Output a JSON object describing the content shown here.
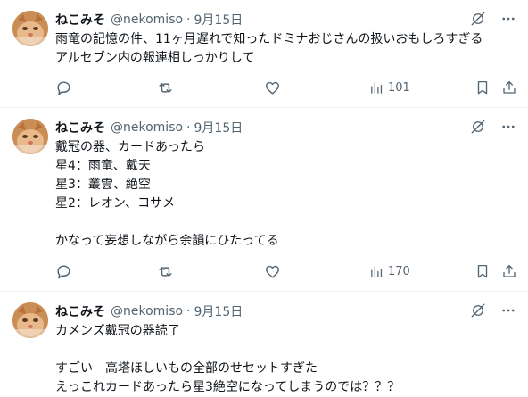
{
  "tweets": [
    {
      "name": "ねこみそ",
      "handle": "@nekomiso",
      "separator": "·",
      "date": "9月15日",
      "lines": [
        "雨竜の記憶の件、11ヶ月遅れで知ったドミナおじさんの扱いおもしろすぎる",
        "アルセブン内の報連相しっかりして"
      ],
      "views": "101"
    },
    {
      "name": "ねこみそ",
      "handle": "@nekomiso",
      "separator": "·",
      "date": "9月15日",
      "lines": [
        "戴冠の器、カードあったら",
        "星4：雨竜、戴天",
        "星3：叢雲、絶空",
        "星2：レオン、コサメ",
        "",
        "かなって妄想しながら余韻にひたってる"
      ],
      "views": "170"
    },
    {
      "name": "ねこみそ",
      "handle": "@nekomiso",
      "separator": "·",
      "date": "9月15日",
      "lines": [
        "カメンズ戴冠の器読了",
        "",
        "すごい　高塔ほしいもの全部のせセットすぎた",
        "えっこれカードあったら星3絶空になってしまうのでは？？？"
      ],
      "views": ""
    }
  ],
  "icons": {
    "reply": "reply-icon",
    "repost": "repost-icon",
    "like": "like-icon",
    "views": "views-icon",
    "bookmark": "bookmark-icon",
    "share": "share-icon",
    "grok": "grok-icon",
    "more": "more-icon"
  },
  "colors": {
    "text": "#0f1419",
    "secondary": "#536471",
    "divider": "#eff3f4"
  }
}
